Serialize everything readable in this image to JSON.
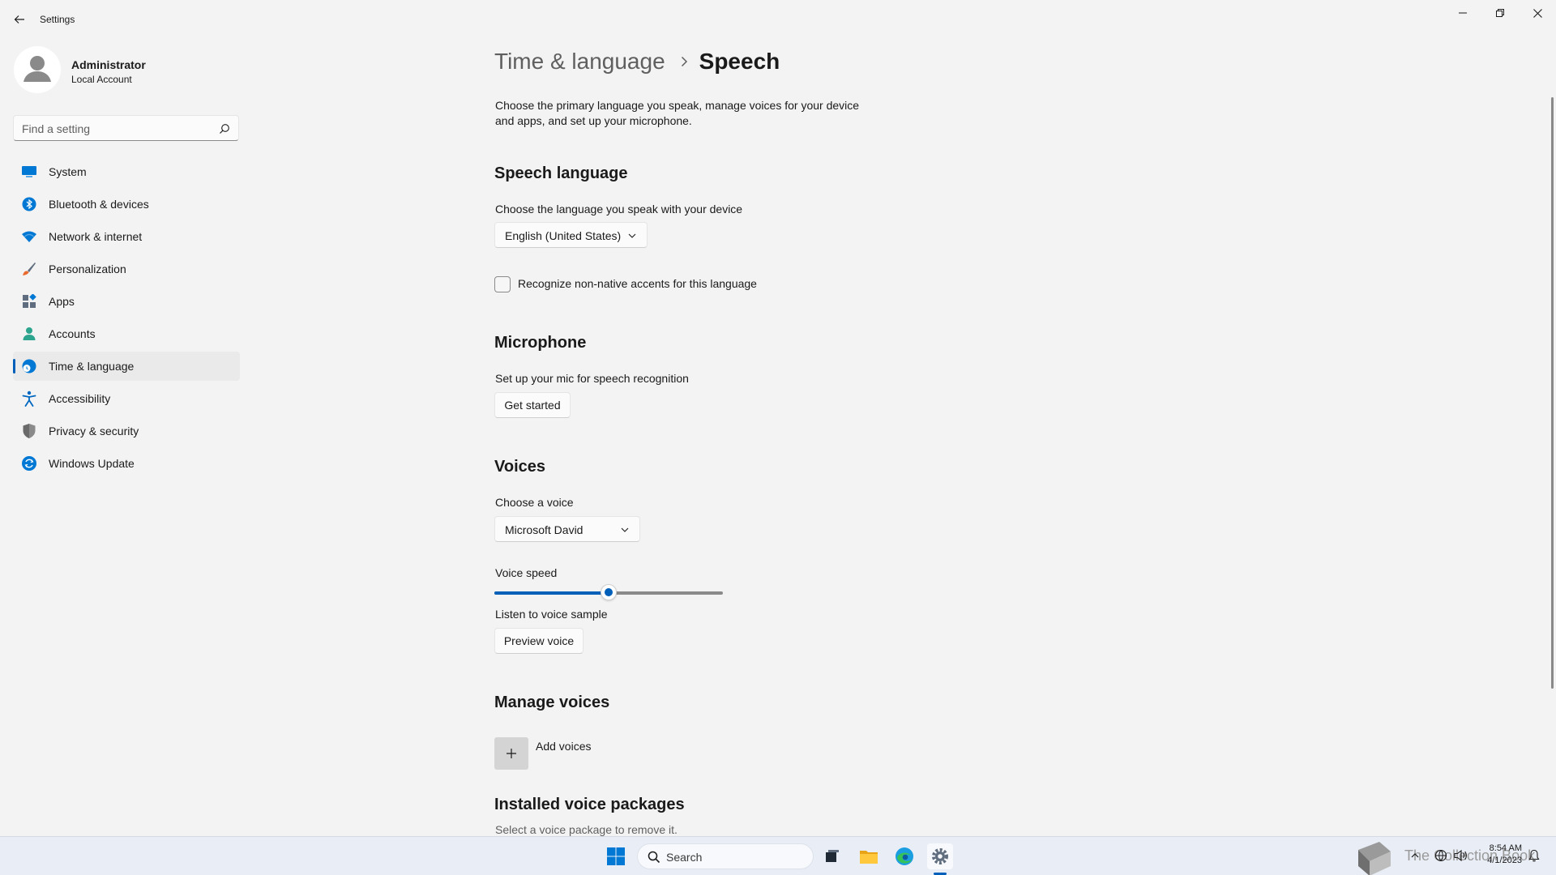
{
  "window": {
    "title": "Settings",
    "controls": {
      "minimize": "minimize",
      "restore": "restore",
      "close": "close"
    }
  },
  "profile": {
    "name": "Administrator",
    "account_type": "Local Account"
  },
  "search": {
    "placeholder": "Find a setting"
  },
  "sidebar": {
    "active_index": 6,
    "items": [
      {
        "label": "System",
        "icon": "monitor-icon",
        "color": "#0078d4"
      },
      {
        "label": "Bluetooth & devices",
        "icon": "bluetooth-icon",
        "color": "#0078d4"
      },
      {
        "label": "Network & internet",
        "icon": "wifi-icon",
        "color": "#0078d4"
      },
      {
        "label": "Personalization",
        "icon": "brush-icon",
        "color": "#e86a2e"
      },
      {
        "label": "Apps",
        "icon": "apps-icon",
        "color": "#5f6d7e"
      },
      {
        "label": "Accounts",
        "icon": "person-icon",
        "color": "#2da58e"
      },
      {
        "label": "Time & language",
        "icon": "globe-clock-icon",
        "color": "#0078d4"
      },
      {
        "label": "Accessibility",
        "icon": "accessibility-icon",
        "color": "#0067c0"
      },
      {
        "label": "Privacy & security",
        "icon": "shield-icon",
        "color": "#7a7a7a"
      },
      {
        "label": "Windows Update",
        "icon": "update-icon",
        "color": "#0078d4"
      }
    ]
  },
  "breadcrumb": {
    "parent": "Time & language",
    "current": "Speech"
  },
  "intro": "Choose the primary language you speak, manage voices for your device and apps, and set up your microphone.",
  "speech_language": {
    "title": "Speech language",
    "label": "Choose the language you speak with your device",
    "selected": "English (United States)",
    "checkbox_label": "Recognize non-native accents for this language",
    "checkbox_checked": false
  },
  "microphone": {
    "title": "Microphone",
    "label": "Set up your mic for speech recognition",
    "button": "Get started"
  },
  "voices": {
    "title": "Voices",
    "choose_label": "Choose a voice",
    "selected_voice": "Microsoft David",
    "speed_label": "Voice speed",
    "speed_fraction": 0.5,
    "sample_label": "Listen to voice sample",
    "preview_button": "Preview voice"
  },
  "manage_voices": {
    "title": "Manage voices",
    "add_label": "Add voices"
  },
  "installed": {
    "title": "Installed voice packages",
    "note": "Select a voice package to remove it."
  },
  "taskbar": {
    "search_label": "Search",
    "watermark": "The Collection Book",
    "time": "8:54 AM",
    "date": "4/1/2023",
    "accent": "#005fb8"
  }
}
